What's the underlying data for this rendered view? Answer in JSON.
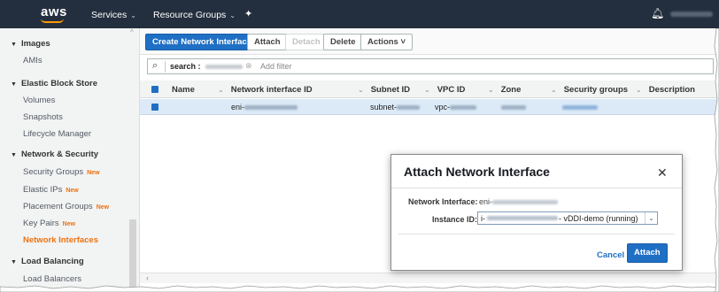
{
  "topnav": {
    "logo": "aws",
    "services": "Services",
    "resource_groups": "Resource Groups",
    "pin_icon": "pin-icon",
    "bell_icon": "bell-icon"
  },
  "sidebar": {
    "sections": [
      {
        "label": "Images",
        "items": [
          {
            "label": "AMIs"
          }
        ]
      },
      {
        "label": "Elastic Block Store",
        "items": [
          {
            "label": "Volumes"
          },
          {
            "label": "Snapshots"
          },
          {
            "label": "Lifecycle Manager"
          }
        ]
      },
      {
        "label": "Network & Security",
        "items": [
          {
            "label": "Security Groups",
            "badge": "New"
          },
          {
            "label": "Elastic IPs",
            "badge": "New"
          },
          {
            "label": "Placement Groups",
            "badge": "New"
          },
          {
            "label": "Key Pairs",
            "badge": "New"
          },
          {
            "label": "Network Interfaces",
            "active": true
          }
        ]
      },
      {
        "label": "Load Balancing",
        "items": [
          {
            "label": "Load Balancers"
          }
        ]
      }
    ]
  },
  "toolbar": {
    "create_label": "Create Network Interface",
    "attach_label": "Attach",
    "detach_label": "Detach",
    "delete_label": "Delete",
    "actions_label": "Actions"
  },
  "search": {
    "token_key": "search :",
    "placeholder": "Add filter"
  },
  "table": {
    "columns": [
      "Name",
      "Network interface ID",
      "Subnet ID",
      "VPC ID",
      "Zone",
      "Security groups",
      "Description"
    ],
    "row": {
      "eni_prefix": "eni-",
      "subnet_prefix": "subnet-",
      "vpc_prefix": "vpc-"
    }
  },
  "dialog": {
    "title": "Attach Network Interface",
    "network_interface_label": "Network Interface:",
    "network_interface_value": "eni-",
    "instance_id_label": "Instance ID:",
    "instance_prefix": "i-",
    "instance_suffix": "- vDDI-demo (running)",
    "cancel_label": "Cancel",
    "attach_label": "Attach"
  },
  "colors": {
    "nav_bg": "#232f3e",
    "primary": "#1f6fc5",
    "accent": "#ec7211",
    "row_selected": "#dceaf7"
  }
}
